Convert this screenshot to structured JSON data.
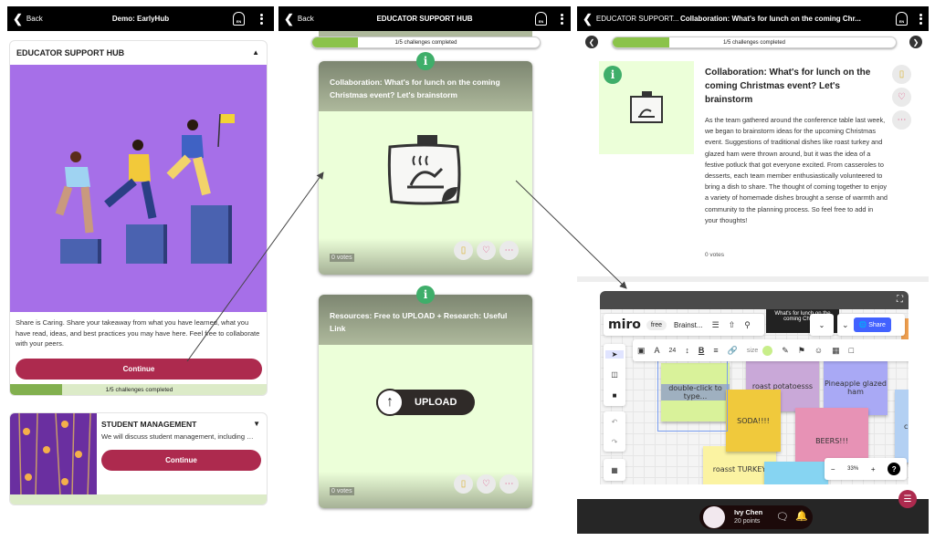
{
  "panel1": {
    "header": {
      "back": "Back",
      "title": "Demo: EarlyHub",
      "lang": "EN"
    },
    "hub_card": {
      "title": "EDUCATOR SUPPORT HUB",
      "description": "Share is Caring. Share your takeaway from what you have learned, what you have read, ideas, and best practices you may have here. Feel free to collaborate with your peers.",
      "continue": "Continue",
      "progress_text": "1/5 challenges completed",
      "progress": 0.2
    },
    "student_card": {
      "title": "STUDENT MANAGEMENT",
      "description": "We will discuss student management, including …",
      "continue": "Continue"
    }
  },
  "panel2": {
    "header": {
      "back": "Back",
      "title": "EDUCATOR SUPPORT HUB",
      "lang": "EN"
    },
    "progress_text": "1/5 challenges completed",
    "progress": 0.2,
    "challenges": [
      {
        "title": "Collaboration: What's for lunch on the coming Christmas event? Let's brainstorm",
        "votes": "0 votes",
        "image": "roast-turkey-icon"
      },
      {
        "title": "Resources: Free to UPLOAD + Research: Useful Link",
        "votes": "0 votes",
        "upload_label": "UPLOAD"
      }
    ]
  },
  "panel3": {
    "header": {
      "back": "EDUCATOR SUPPORT...",
      "title": "Collaboration: What's for lunch on the coming Chr...",
      "lang": "EN"
    },
    "progress_text": "1/5 challenges completed",
    "progress": 0.2,
    "detail": {
      "title": "Collaboration: What's for lunch on the coming Christmas event? Let's brainstorm",
      "body": "As the team gathered around the conference table last week, we began to brainstorm ideas for the upcoming Christmas event. Suggestions of traditional dishes like roast turkey and glazed ham were thrown around, but it was the idea of a festive potluck that got everyone excited. From casseroles to desserts, each team member enthusiastically volunteered to bring a dish to share. The thought of coming together to enjoy a variety of homemade dishes brought a sense of warmth and community to the planning process. So feel free to add in your thoughts!",
      "votes": "0 votes"
    },
    "miro": {
      "logo": "miro",
      "plan": "free",
      "board": "Brainst...",
      "share": "Share",
      "font_size": "24",
      "size_label": "size",
      "zoom": "33%",
      "tooltip": "What's for lunch on the coming Christ...",
      "stickies": [
        {
          "text": "double-click to type...",
          "color": "#d9f29a"
        },
        {
          "text": "roast potatoesss",
          "color": "#c9a8d8"
        },
        {
          "text": "Pineapple glazed ham",
          "color": "#a9a9f5"
        },
        {
          "text": "SODA!!!!",
          "color": "#f0c93c"
        },
        {
          "text": "BEERS!!!",
          "color": "#e792b5"
        },
        {
          "text": "roasst TURKEY",
          "color": "#fbf3a2"
        },
        {
          "text": "c",
          "color": "#b3d0f3"
        }
      ]
    },
    "user": {
      "name": "Ivy Chen",
      "points": "20 points"
    }
  },
  "colors": {
    "accent": "#ad2a4e",
    "progress": "#8bc34a",
    "info": "#3fae6a",
    "card_bg": "#ecffd9"
  }
}
